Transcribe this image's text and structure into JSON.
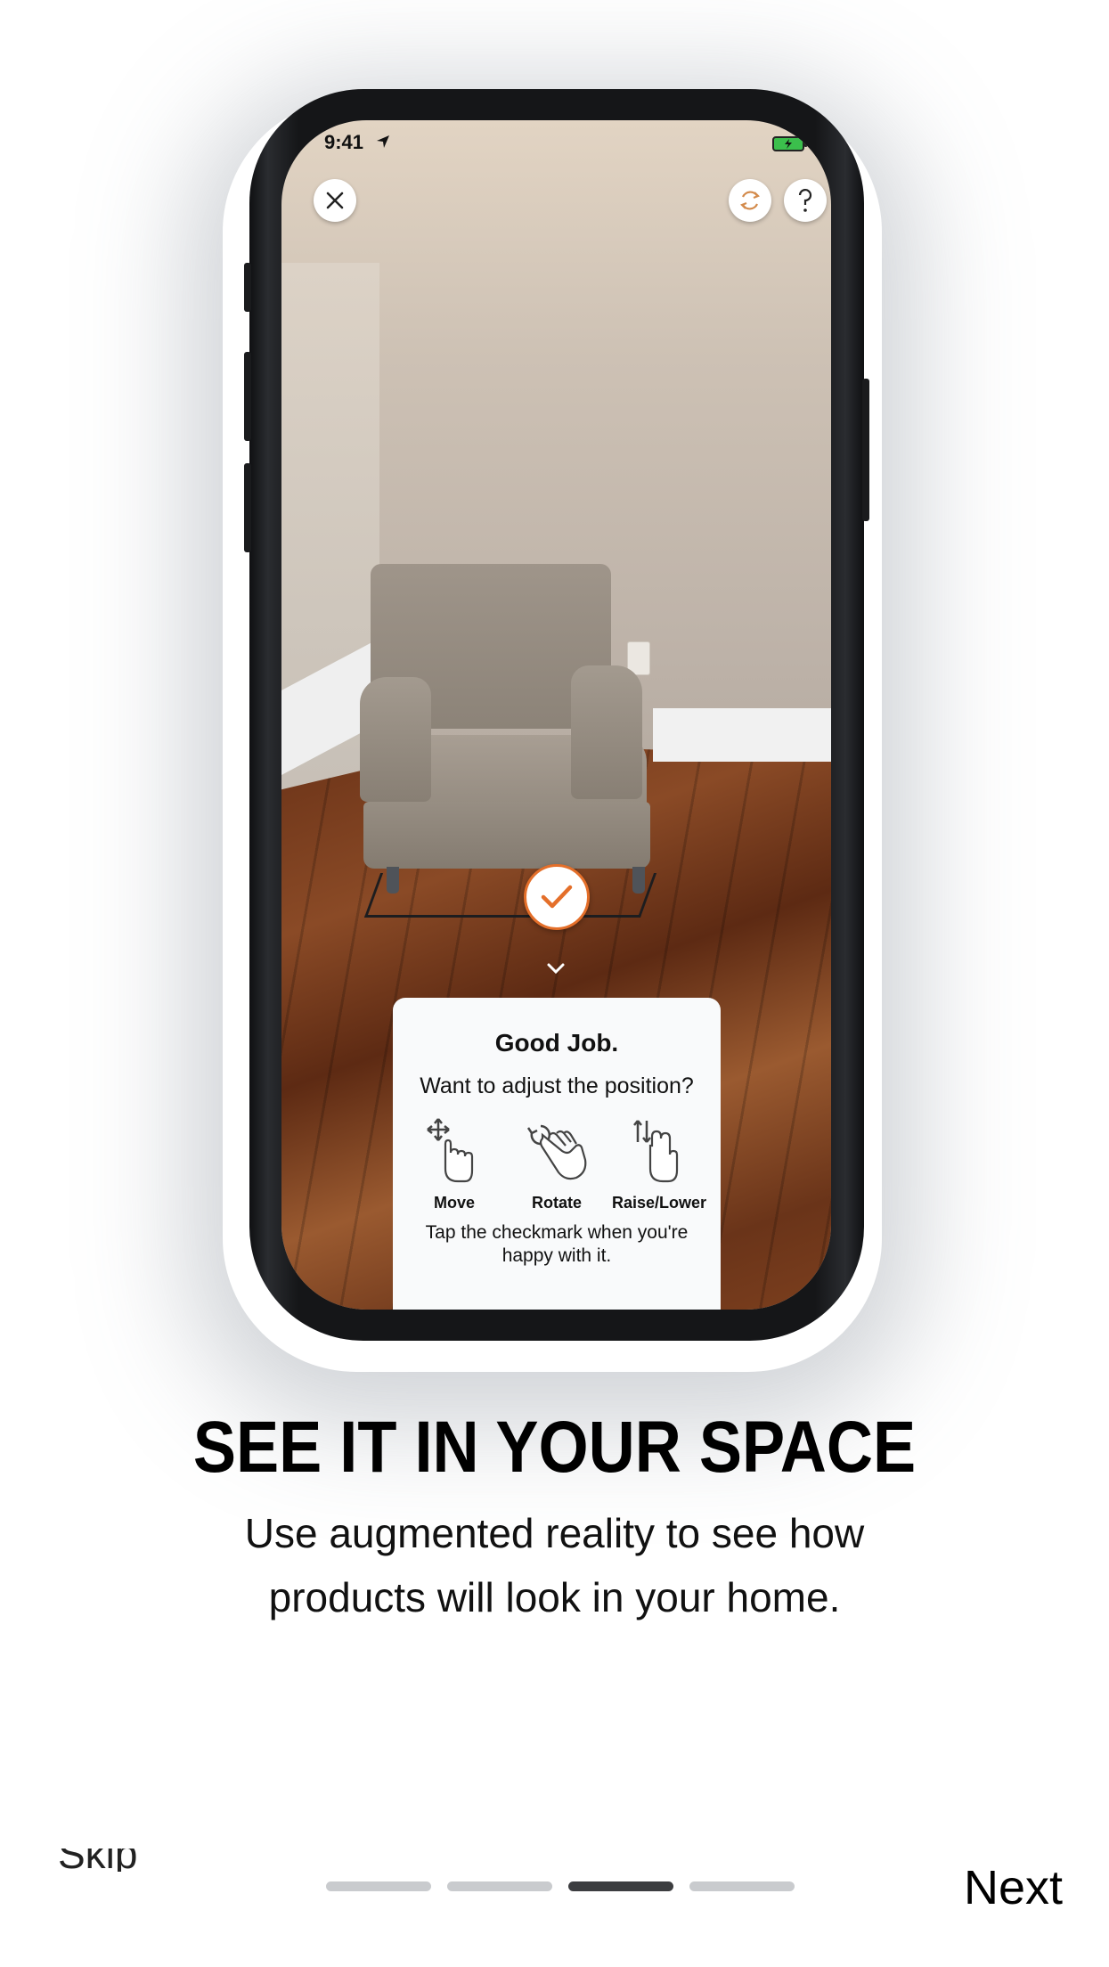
{
  "status_bar": {
    "time": "9:41"
  },
  "tip_card": {
    "title": "Good Job.",
    "subtitle": "Want to adjust the position?",
    "gestures": [
      {
        "label": "Move",
        "icon": "move-hand-icon"
      },
      {
        "label": "Rotate",
        "icon": "rotate-hand-icon"
      },
      {
        "label": "Raise/Lower",
        "icon": "raise-lower-hand-icon"
      }
    ],
    "note": "Tap the checkmark when you're happy with it."
  },
  "onboarding": {
    "headline": "SEE IT IN YOUR SPACE",
    "description": "Use augmented reality to see how products will look in your home."
  },
  "footer": {
    "skip_label": "Skip",
    "next_label": "Next",
    "pages": 4,
    "active_page": 3
  },
  "colors": {
    "accent": "#e46f2a",
    "dot_inactive": "#c9cbce",
    "dot_active": "#3c3d40"
  }
}
